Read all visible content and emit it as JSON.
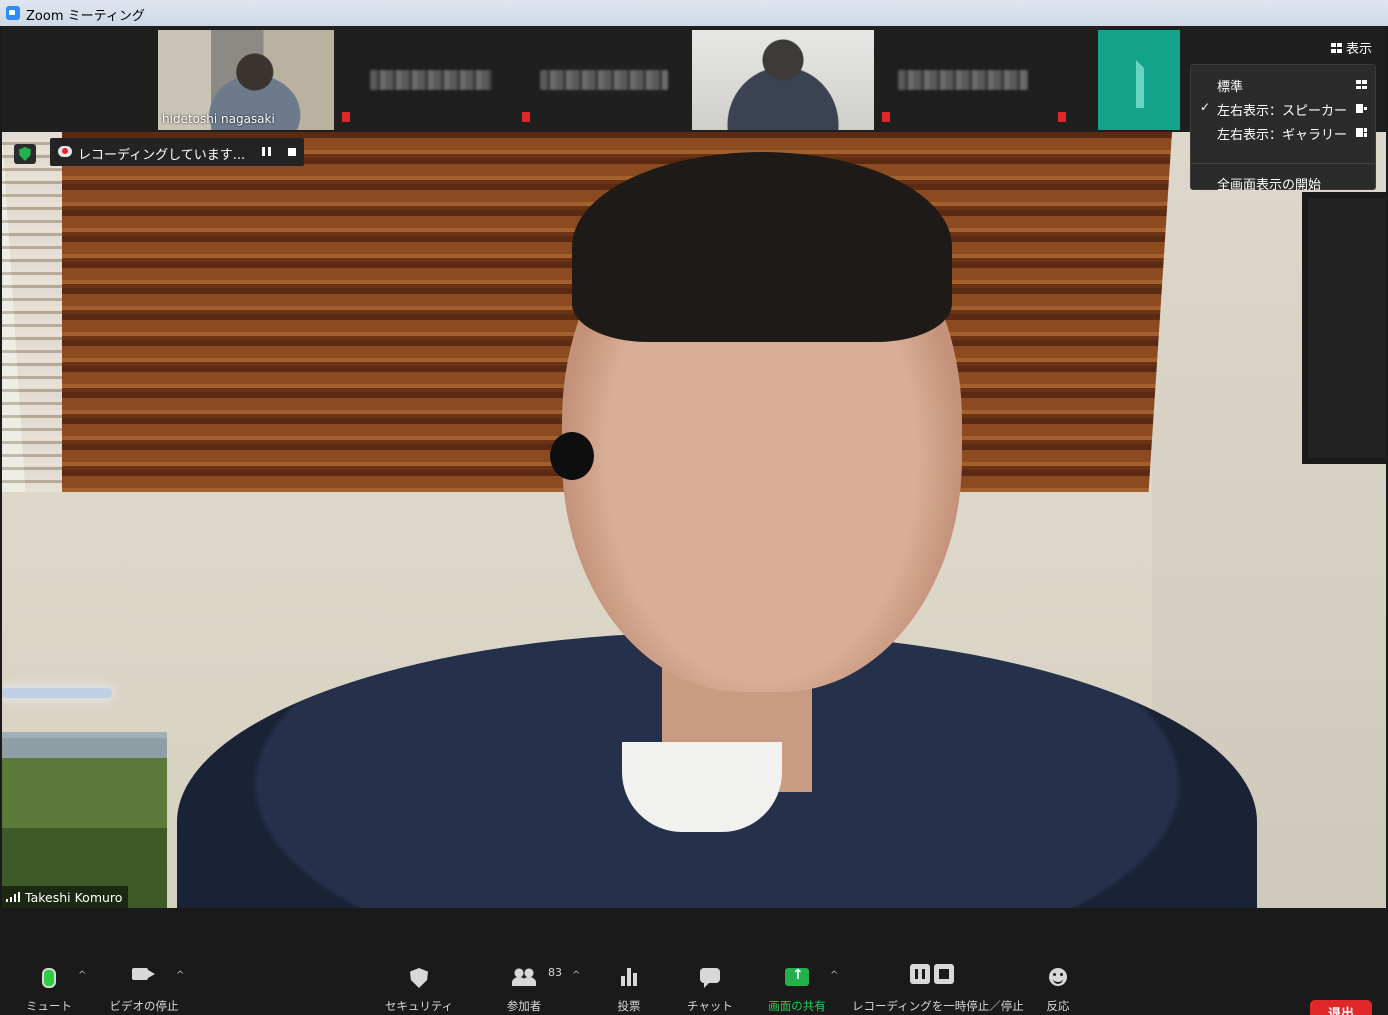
{
  "window": {
    "title": "Zoom ミーティング"
  },
  "view_button": {
    "label": "表示"
  },
  "view_menu": {
    "items": [
      {
        "label": "標準",
        "checked": false,
        "icon": "grid-icon"
      },
      {
        "label": "左右表示：スピーカー",
        "checked": true,
        "icon": "side-speaker-icon"
      },
      {
        "label": "左右表示：ギャラリー",
        "checked": false,
        "icon": "side-gallery-icon"
      }
    ],
    "fullscreen": "全画面表示の開始",
    "check_mark": "✓"
  },
  "participants_strip": [
    {
      "name": "hidetoshi nagasaki",
      "type": "video"
    },
    {
      "name": "",
      "type": "name-only"
    },
    {
      "name": "",
      "type": "name-only"
    },
    {
      "name": "",
      "type": "video"
    },
    {
      "name": "",
      "type": "name-only"
    },
    {
      "name": "",
      "type": "avatar"
    }
  ],
  "recording": {
    "status": "レコーディングしています..."
  },
  "speaker": {
    "name": "Takeshi Komuro"
  },
  "toolbar": {
    "mute": "ミュート",
    "stop_video": "ビデオの停止",
    "security": "セキュリティ",
    "participants": "参加者",
    "participants_count": "83",
    "polls": "投票",
    "chat": "チャット",
    "share_screen": "画面の共有",
    "recording_control": "レコーディングを一時停止／停止",
    "reactions": "反応",
    "leave": "退出",
    "caret": "^"
  },
  "colors": {
    "accent_green": "#22b14c",
    "leave_red": "#e02828",
    "toolbar_bg": "#1a1a1a"
  }
}
